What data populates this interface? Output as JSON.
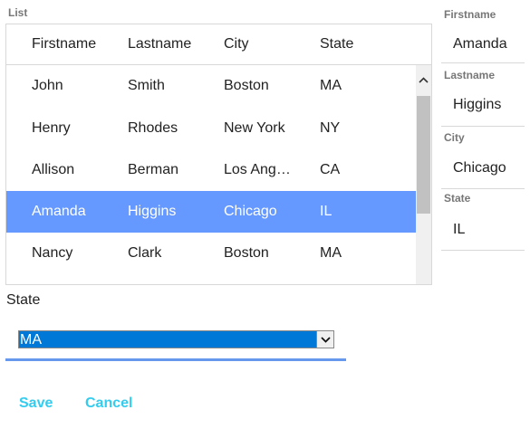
{
  "list": {
    "label": "List",
    "columns": [
      "Firstname",
      "Lastname",
      "City",
      "State"
    ],
    "rows": [
      {
        "firstname": "John",
        "lastname": "Smith",
        "city": "Boston",
        "state": "MA"
      },
      {
        "firstname": "Henry",
        "lastname": "Rhodes",
        "city": "New York",
        "state": "NY"
      },
      {
        "firstname": "Allison",
        "lastname": "Berman",
        "city": "Los Angeles",
        "state": "CA"
      },
      {
        "firstname": "Amanda",
        "lastname": "Higgins",
        "city": "Chicago",
        "state": "IL"
      },
      {
        "firstname": "Nancy",
        "lastname": "Clark",
        "city": "Boston",
        "state": "MA"
      }
    ],
    "selected_row": 3,
    "selection_color": "#6699ff"
  },
  "detail": {
    "firstname": {
      "label": "Firstname",
      "value": "Amanda"
    },
    "lastname": {
      "label": "Lastname",
      "value": "Higgins"
    },
    "city": {
      "label": "City",
      "value": "Chicago"
    },
    "state": {
      "label": "State",
      "value": "IL"
    }
  },
  "editor": {
    "state_label": "State",
    "state_selected": "MA",
    "save_label": "Save",
    "cancel_label": "Cancel",
    "link_color": "#33ccee"
  }
}
